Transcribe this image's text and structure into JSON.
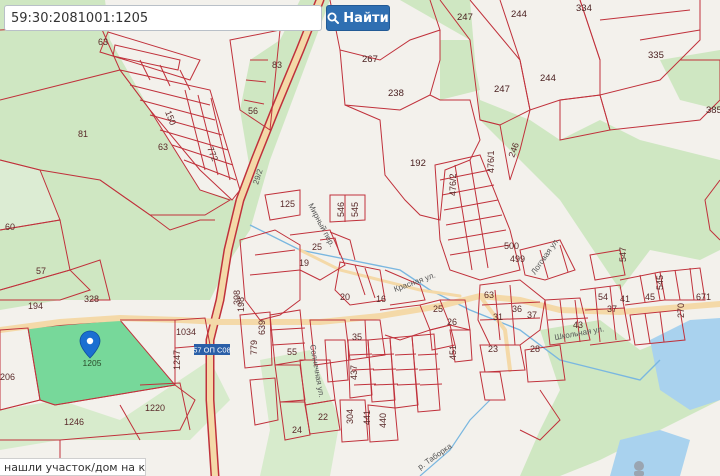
{
  "search": {
    "query": "59:30:2081001:1205",
    "button_label": "Найти"
  },
  "prompt": {
    "text": "нашли участок/дом на карте?"
  },
  "marker": {
    "label": "1205"
  },
  "road_badge": "57 ОП С08",
  "road_names": {
    "main_highway": "29/2",
    "street_1": "Мирный пер.",
    "street_2": "Красная ул.",
    "street_3": "Солнечная ул.",
    "street_4": "Песчаная ул.",
    "street_5": "Школьная ул.",
    "river": "р. Таборка",
    "street_6": "Логовая ул."
  },
  "parcels": [
    "63",
    "83",
    "81",
    "63",
    "56",
    "150",
    "772",
    "267",
    "238",
    "247",
    "244",
    "334",
    "335",
    "247",
    "244",
    "385",
    "192",
    "246",
    "476/1",
    "476/2",
    "125",
    "546",
    "545",
    "60",
    "57",
    "194",
    "328",
    "1034",
    "1247",
    "1220",
    "1246",
    "206",
    "500",
    "499",
    "547",
    "545",
    "41",
    "45",
    "37",
    "37",
    "54",
    "270",
    "25",
    "26",
    "451",
    "23",
    "28",
    "55",
    "779",
    "639",
    "198",
    "20",
    "16",
    "35",
    "437",
    "441",
    "440",
    "304",
    "22",
    "24",
    "398",
    "19",
    "25",
    "31",
    "36",
    "43",
    "63",
    "671"
  ],
  "colors": {
    "parcel_line": "#c0313b",
    "forest": "#cfe7c2",
    "field": "#f5f3ee",
    "selected": "#77d89a",
    "water": "#a9d2ee",
    "road": "#f4d9a8",
    "marker": "#1a6fd1",
    "button": "#2f6fb2"
  }
}
